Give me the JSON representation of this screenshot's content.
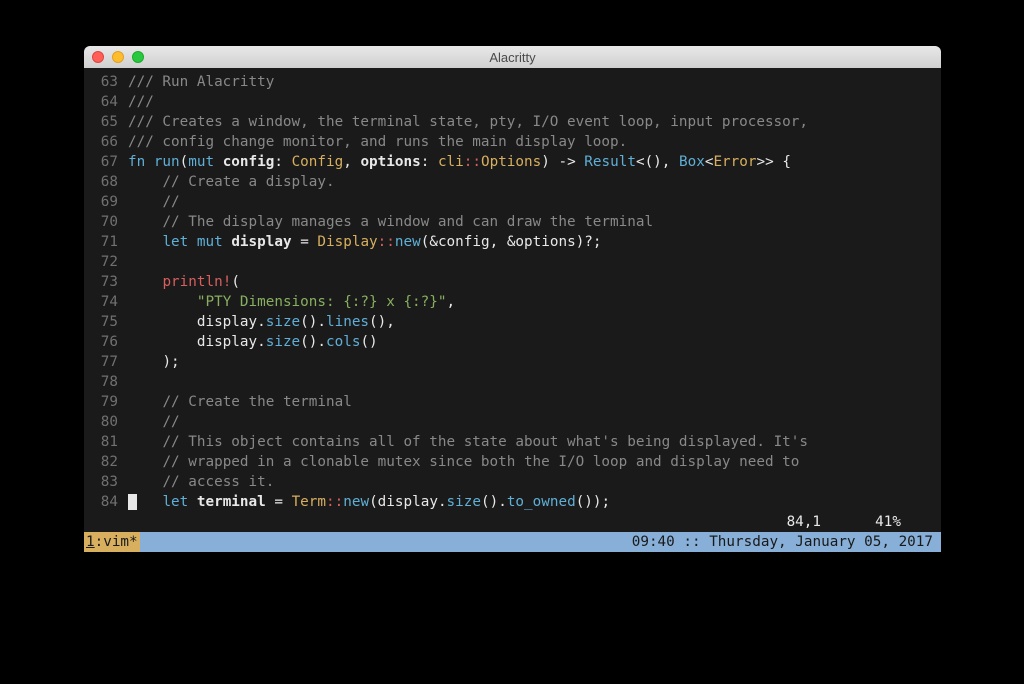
{
  "window": {
    "title": "Alacritty"
  },
  "editor": {
    "lines": [
      {
        "n": "63",
        "html": "<span class='cmt'>/// Run Alacritty</span>"
      },
      {
        "n": "64",
        "html": "<span class='cmt'>///</span>"
      },
      {
        "n": "65",
        "html": "<span class='cmt'>/// Creates a window, the terminal state, pty, I/O event loop, input processor,</span>"
      },
      {
        "n": "66",
        "html": "<span class='cmt'>/// config change monitor, and runs the main display loop.</span>"
      },
      {
        "n": "67",
        "html": "<span class='kw2'>fn</span> <span class='fn'>run</span><span class='pn'>(</span><span class='kw2'>mut</span> <span class='id'>config</span><span class='pn'>:</span> <span class='ty'>Config</span><span class='pn'>,</span> <span class='id'>options</span><span class='pn'>:</span> <span class='ty'>cli</span><span class='ns'>::</span><span class='ty'>Options</span><span class='pn'>)</span> <span class='op'>-&gt;</span> <span class='ty2'>Result</span><span class='op'>&lt;</span><span class='pn'>()</span><span class='pn'>,</span> <span class='ty2'>Box</span><span class='op'>&lt;</span><span class='ty'>Error</span><span class='op'>&gt;&gt;</span> <span class='pn'>{</span>"
      },
      {
        "n": "68",
        "html": "    <span class='cmt'>// Create a display.</span>"
      },
      {
        "n": "69",
        "html": "    <span class='cmt'>//</span>"
      },
      {
        "n": "70",
        "html": "    <span class='cmt'>// The display manages a window and can draw the terminal</span>"
      },
      {
        "n": "71",
        "html": "    <span class='kw2'>let</span> <span class='kw2'>mut</span> <span class='id'>display</span> <span class='op'>=</span> <span class='ty'>Display</span><span class='ns'>::</span><span class='fn'>new</span><span class='pn'>(</span><span class='op'>&amp;</span>config<span class='pn'>,</span> <span class='op'>&amp;</span>options<span class='pn'>)</span><span class='op'>?</span><span class='pn'>;</span>"
      },
      {
        "n": "72",
        "html": ""
      },
      {
        "n": "73",
        "html": "    <span class='mac'>println!</span><span class='pn'>(</span>"
      },
      {
        "n": "74",
        "html": "        <span class='str'>\"PTY Dimensions: {:?} x {:?}\"</span><span class='pn'>,</span>"
      },
      {
        "n": "75",
        "html": "        display<span class='pn'>.</span><span class='fn'>size</span><span class='pn'>()</span><span class='pn'>.</span><span class='fn'>lines</span><span class='pn'>()</span><span class='pn'>,</span>"
      },
      {
        "n": "76",
        "html": "        display<span class='pn'>.</span><span class='fn'>size</span><span class='pn'>()</span><span class='pn'>.</span><span class='fn'>cols</span><span class='pn'>()</span>"
      },
      {
        "n": "77",
        "html": "    <span class='pn'>);</span>"
      },
      {
        "n": "78",
        "html": ""
      },
      {
        "n": "79",
        "html": "    <span class='cmt'>// Create the terminal</span>"
      },
      {
        "n": "80",
        "html": "    <span class='cmt'>//</span>"
      },
      {
        "n": "81",
        "html": "    <span class='cmt'>// This object contains all of the state about what's being displayed. It's</span>"
      },
      {
        "n": "82",
        "html": "    <span class='cmt'>// wrapped in a clonable mutex since both the I/O loop and display need to</span>"
      },
      {
        "n": "83",
        "html": "    <span class='cmt'>// access it.</span>"
      },
      {
        "n": "84",
        "html": "<span class='cursor'> </span>   <span class='kw2'>let</span> <span class='id'>terminal</span> <span class='op'>=</span> <span class='ty'>Term</span><span class='ns'>::</span><span class='fn'>new</span><span class='pn'>(</span>display<span class='pn'>.</span><span class='fn'>size</span><span class='pn'>()</span><span class='pn'>.</span><span class='fn'>to_owned</span><span class='pn'>())</span><span class='pn'>;</span>"
      }
    ],
    "cursor_pos": "84,1",
    "scroll_pct": "41%"
  },
  "tmux": {
    "session_num": "1",
    "session_name": ":vim*",
    "datetime": "09:40 :: Thursday, January 05, 2017"
  }
}
